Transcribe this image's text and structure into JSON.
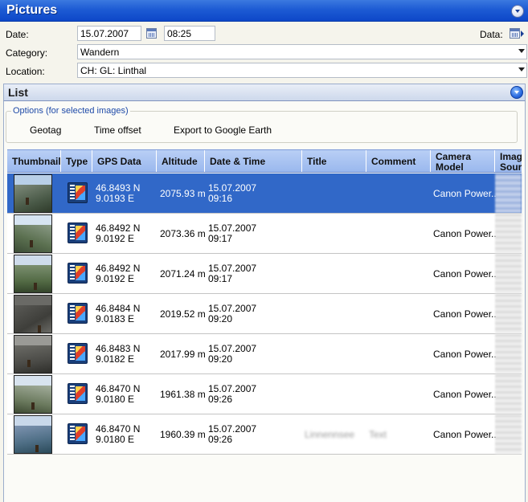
{
  "pictures": {
    "title": "Pictures",
    "date_label": "Date:",
    "date_value": "15.07.2007",
    "time_value": "08:25",
    "data_label": "Data:",
    "category_label": "Category:",
    "category_value": "Wandern",
    "location_label": "Location:",
    "location_value": "CH: GL: Linthal"
  },
  "list": {
    "title": "List",
    "options_legend": "Options (for selected images)",
    "options": [
      "Geotag",
      "Time offset",
      "Export to Google Earth"
    ]
  },
  "table": {
    "columns": [
      {
        "label": "Thumbnail"
      },
      {
        "label": "Type"
      },
      {
        "label": "GPS Data"
      },
      {
        "label": "Altitude"
      },
      {
        "label": "Date & Time"
      },
      {
        "label": "Title"
      },
      {
        "label": "Comment"
      },
      {
        "label": "Camera Model"
      },
      {
        "label": "Imag Sour"
      }
    ],
    "rows": [
      {
        "lat": "46.8493 N",
        "lon": "9.0193 E",
        "altitude": "2075.93 m",
        "date": "15.07.2007",
        "time": "09:16",
        "title": "",
        "comment": "",
        "camera": "Canon Power...",
        "selected": true
      },
      {
        "lat": "46.8492 N",
        "lon": "9.0192 E",
        "altitude": "2073.36 m",
        "date": "15.07.2007",
        "time": "09:17",
        "title": "",
        "comment": "",
        "camera": "Canon Power...",
        "selected": false
      },
      {
        "lat": "46.8492 N",
        "lon": "9.0192 E",
        "altitude": "2071.24 m",
        "date": "15.07.2007",
        "time": "09:17",
        "title": "",
        "comment": "",
        "camera": "Canon Power...",
        "selected": false
      },
      {
        "lat": "46.8484 N",
        "lon": "9.0183 E",
        "altitude": "2019.52 m",
        "date": "15.07.2007",
        "time": "09:20",
        "title": "",
        "comment": "",
        "camera": "Canon Power...",
        "selected": false
      },
      {
        "lat": "46.8483 N",
        "lon": "9.0182 E",
        "altitude": "2017.99 m",
        "date": "15.07.2007",
        "time": "09:20",
        "title": "",
        "comment": "",
        "camera": "Canon Power...",
        "selected": false
      },
      {
        "lat": "46.8470 N",
        "lon": "9.0180 E",
        "altitude": "1961.38 m",
        "date": "15.07.2007",
        "time": "09:26",
        "title": "",
        "comment": "",
        "camera": "Canon Power...",
        "selected": false
      },
      {
        "lat": "46.8470 N",
        "lon": "9.0180 E",
        "altitude": "1960.39 m",
        "date": "15.07.2007",
        "time": "09:26",
        "title": "Linnennsee",
        "comment": "Text",
        "camera": "Canon Power...",
        "selected": false
      }
    ]
  },
  "colors": {
    "accent": "#1d5bd4",
    "selection": "#3168c8",
    "header": "#a9c4f2"
  },
  "icons": {
    "collapse": "chevron-down-icon",
    "calendar": "calendar-icon",
    "type": "video-photo-icon"
  }
}
